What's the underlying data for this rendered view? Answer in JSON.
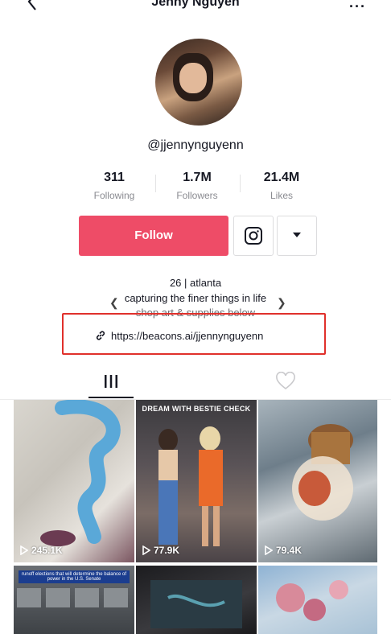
{
  "header": {
    "title": "Jenny Nguyen",
    "back_icon": "chevron-left-icon",
    "more_label": "···"
  },
  "profile": {
    "username": "@jjennynguyenn"
  },
  "stats": [
    {
      "value": "311",
      "label": "Following"
    },
    {
      "value": "1.7M",
      "label": "Followers"
    },
    {
      "value": "21.4M",
      "label": "Likes"
    }
  ],
  "actions": {
    "follow_label": "Follow",
    "follow_color": "#ee4c67",
    "instagram_icon": "instagram-icon",
    "dropdown_icon": "caret-down-icon"
  },
  "bio": {
    "line1": "26 | atlanta",
    "line2": "capturing the finer things in life",
    "line3": "shop art & supplies below",
    "link": "https://beacons.ai/jjennynguyenn"
  },
  "tabs": [
    {
      "name": "videos",
      "icon": "grid-bars-icon"
    },
    {
      "name": "liked",
      "icon": "heart-outline-icon"
    }
  ],
  "videos": [
    {
      "views": "245.1K"
    },
    {
      "views": "77.9K",
      "banner": "DREAM WITH BESTIE CHECK"
    },
    {
      "views": "79.4K"
    },
    {
      "views": "",
      "note": "runoff elections that will determine the balance of power in the U.S. Senate"
    },
    {
      "views": ""
    },
    {
      "views": ""
    }
  ],
  "highlight_color": "#e0302b"
}
